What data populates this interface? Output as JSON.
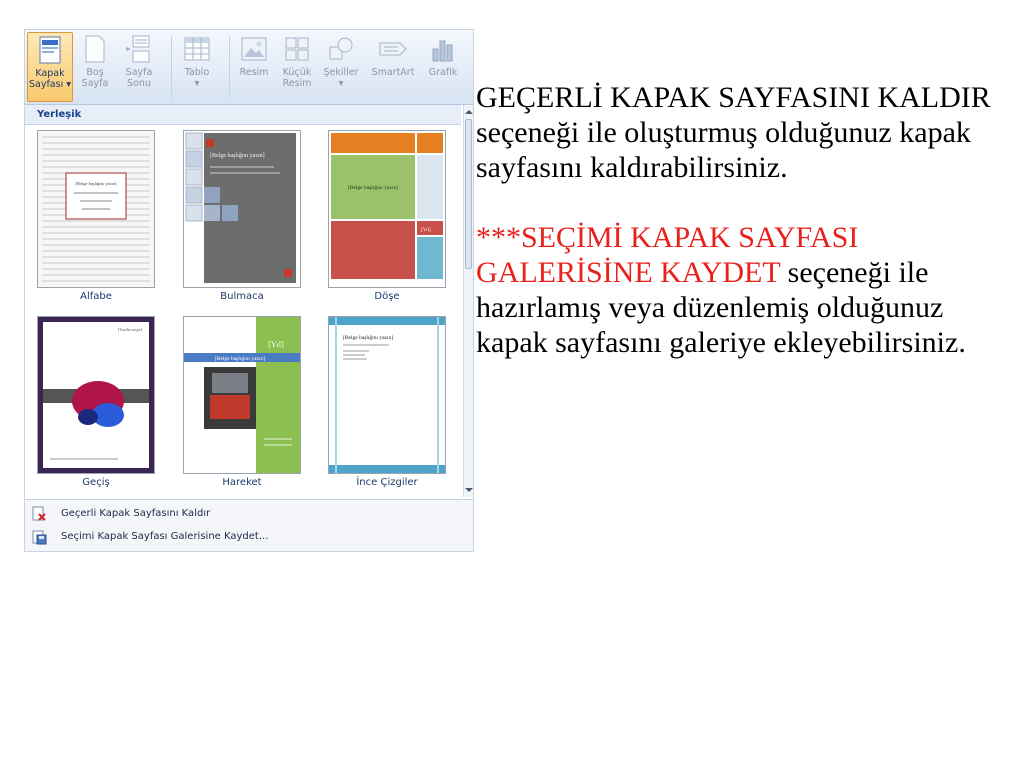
{
  "ribbon": {
    "cover_page": {
      "line1": "Kapak",
      "line2": "Sayfası ▾"
    },
    "blank_page": {
      "line1": "Boş",
      "line2": "Sayfa"
    },
    "page_break": {
      "line1": "Sayfa",
      "line2": "Sonu"
    },
    "table": {
      "line1": "Tablo",
      "line2": "▾"
    },
    "picture": {
      "line1": "Resim"
    },
    "clip_art": {
      "line1": "Küçük",
      "line2": "Resim"
    },
    "shapes": {
      "line1": "Şekiller",
      "line2": "▾"
    },
    "smartart": {
      "line1": "SmartArt"
    },
    "chart": {
      "line1": "Grafik"
    }
  },
  "gallery": {
    "section_header": "Yerleşik",
    "templates": [
      {
        "name": "Alfabe",
        "title_placeholder": "[Belge başlığını yazın]"
      },
      {
        "name": "Bulmaca",
        "title_placeholder": "[Belge başlığını yazın]"
      },
      {
        "name": "Döşe",
        "title_placeholder": "[Belge başlığını yazın]",
        "year_placeholder": "[Yıl]"
      },
      {
        "name": "Geçiş",
        "year_placeholder": "[Tarihi seçin]"
      },
      {
        "name": "Hareket",
        "title_placeholder": "[Belge başlığını yazın]",
        "year_placeholder": "[Yıl]"
      },
      {
        "name": "İnce Çizgiler",
        "title_placeholder": "[Belge başlığını yazın]"
      }
    ]
  },
  "menu": {
    "remove_label": "Geçerli Kapak Sayfasını Kaldır",
    "save_label": "Seçimi Kapak Sayfası Galerisine Kaydet..."
  },
  "description": {
    "para1_upper": "GEÇERLİ KAPAK SAYFASINI KALDIR",
    "para1_rest": " seçeneği ile oluşturmuş olduğunuz kapak sayfasını kaldırabilirsiniz.",
    "para2_red": "***SEÇİMİ KAPAK SAYFASI GALERİSİNE KAYDET",
    "para2_rest": " seçeneği ile hazırlamış veya düzenlemiş olduğunuz kapak sayfasını galeriye ekleyebilirsiniz."
  },
  "colors": {
    "red_text": "#e8221b",
    "ribbon_active": "#f9c96d",
    "label_blue": "#1c3a6b"
  }
}
